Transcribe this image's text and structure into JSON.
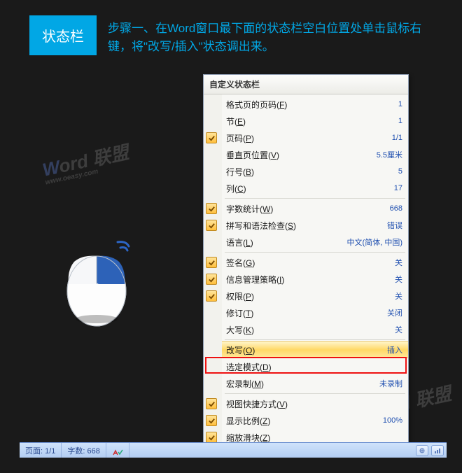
{
  "header": {
    "tag": "状态栏",
    "instruction": "步骤一、在Word窗口最下面的状态栏空白位置处单击鼠标右键，将\"改写/插入\"状态调出来。"
  },
  "watermark": {
    "brand_w": "W",
    "brand_rest": "ord 联盟",
    "url": "www.oeasy.com"
  },
  "taskbar": {
    "page": "页面: 1/1",
    "words": "字数: 668"
  },
  "menu": {
    "title": "自定义状态栏",
    "items": [
      {
        "label": "格式页的页码",
        "key": "F",
        "value": "1",
        "checked": false,
        "sep": false
      },
      {
        "label": "节",
        "key": "E",
        "value": "1",
        "checked": false,
        "sep": false
      },
      {
        "label": "页码",
        "key": "P",
        "value": "1/1",
        "checked": true,
        "sep": false
      },
      {
        "label": "垂直页位置",
        "key": "V",
        "value": "5.5厘米",
        "checked": false,
        "sep": false
      },
      {
        "label": "行号",
        "key": "B",
        "value": "5",
        "checked": false,
        "sep": false
      },
      {
        "label": "列",
        "key": "C",
        "value": "17",
        "checked": false,
        "sep": true
      },
      {
        "label": "字数统计",
        "key": "W",
        "value": "668",
        "checked": true,
        "sep": false
      },
      {
        "label": "拼写和语法检查",
        "key": "S",
        "value": "错误",
        "checked": true,
        "sep": false
      },
      {
        "label": "语言",
        "key": "L",
        "value": "中文(简体, 中国)",
        "checked": false,
        "sep": true
      },
      {
        "label": "签名",
        "key": "G",
        "value": "关",
        "checked": true,
        "sep": false
      },
      {
        "label": "信息管理策略",
        "key": "I",
        "value": "关",
        "checked": true,
        "sep": false
      },
      {
        "label": "权限",
        "key": "P",
        "value": "关",
        "checked": true,
        "sep": false
      },
      {
        "label": "修订",
        "key": "T",
        "value": "关闭",
        "checked": false,
        "sep": false
      },
      {
        "label": "大写",
        "key": "K",
        "value": "关",
        "checked": false,
        "sep": true
      },
      {
        "label": "改写",
        "key": "O",
        "value": "插入",
        "checked": false,
        "sep": false,
        "highlight": true
      },
      {
        "label": "选定模式",
        "key": "D",
        "value": "",
        "checked": false,
        "sep": false
      },
      {
        "label": "宏录制",
        "key": "M",
        "value": "未录制",
        "checked": false,
        "sep": true
      },
      {
        "label": "视图快捷方式",
        "key": "V",
        "value": "",
        "checked": true,
        "sep": false
      },
      {
        "label": "显示比例",
        "key": "Z",
        "value": "100%",
        "checked": true,
        "sep": false
      },
      {
        "label": "缩放滑块",
        "key": "Z",
        "value": "",
        "checked": true,
        "sep": false
      }
    ]
  }
}
